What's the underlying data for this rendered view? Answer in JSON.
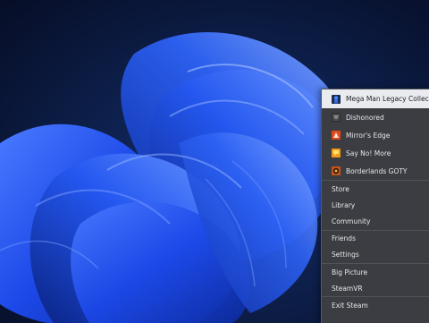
{
  "context_menu": {
    "recent_games": [
      {
        "label": "Mega Man Legacy Collection",
        "icon": "mega-man-icon",
        "highlighted": true
      },
      {
        "label": "Dishonored",
        "icon": "dishonored-icon",
        "highlighted": false
      },
      {
        "label": "Mirror's Edge",
        "icon": "mirrors-edge-icon",
        "highlighted": false
      },
      {
        "label": "Say No! More",
        "icon": "say-no-more-icon",
        "highlighted": false
      },
      {
        "label": "Borderlands GOTY",
        "icon": "borderlands-icon",
        "highlighted": false
      }
    ],
    "nav": [
      {
        "label": "Store"
      },
      {
        "label": "Library"
      },
      {
        "label": "Community"
      }
    ],
    "social": [
      {
        "label": "Friends"
      },
      {
        "label": "Settings"
      }
    ],
    "modes": [
      {
        "label": "Big Picture"
      },
      {
        "label": "SteamVR"
      }
    ],
    "exit": {
      "label": "Exit Steam"
    }
  },
  "colors": {
    "menu_bg": "#3b3d42",
    "menu_text": "#e6e7e9",
    "highlight_bg": "#e9ebee",
    "wallpaper_dark": "#0a1530",
    "wallpaper_blue": "#1f4fe0"
  }
}
